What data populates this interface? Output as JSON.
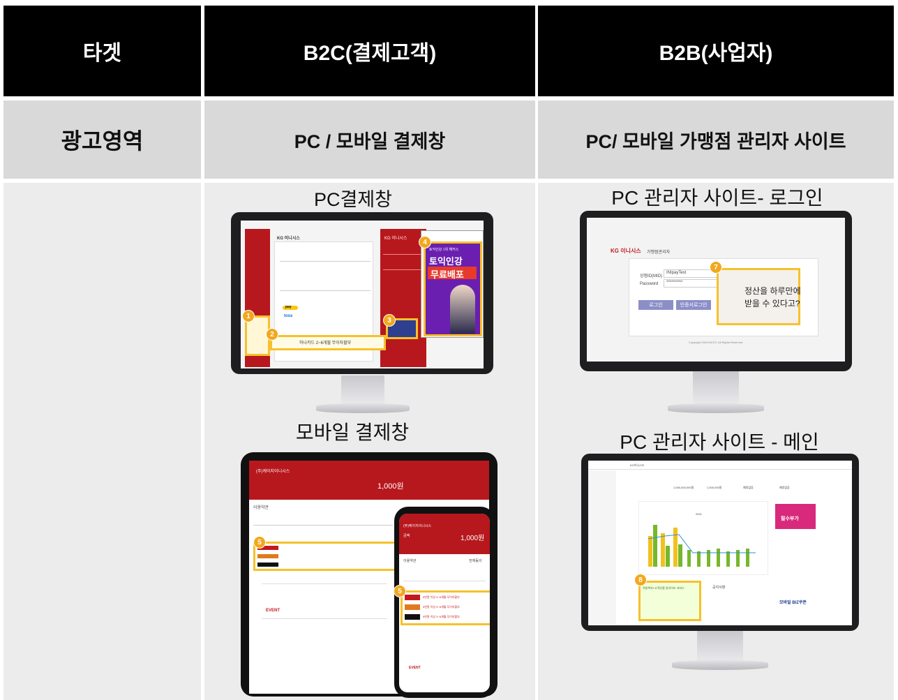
{
  "header": {
    "col1": "타겟",
    "col2": "B2C(결제고객)",
    "col3": "B2B(사업자)"
  },
  "subheader": {
    "col1": "광고영역",
    "col2": "PC / 모바일 결제창",
    "col3": "PC/ 모바일 가맹점 관리자 사이트"
  },
  "b2c": {
    "pc_caption": "PC결제창",
    "mobile_caption": "모바일 결제창",
    "pc_screen": {
      "brand": "KG 이니시스",
      "ad_line1": "토익인강 1위 해커스",
      "ad_line2": "토익인강",
      "ad_line3": "무료배포",
      "card_banner": "하나카드 2~6개월 무이자할부",
      "pay_label": "pay",
      "toss_label": "toss",
      "badges": [
        "1",
        "2",
        "3",
        "4"
      ]
    },
    "mobile_screen": {
      "merchant": "(주)케이지이니시스",
      "amount_label": "금액",
      "amount": "1,000원",
      "terms": "이용약관",
      "agree_all": "전체동의",
      "badge": "5",
      "event_label": "EVENT",
      "rows": [
        "신한카드",
        "KB국민카드",
        "현대카드"
      ],
      "row_text": "5만원 이상 3~6개월 무이자할부"
    }
  },
  "b2b": {
    "login_caption": "PC 관리자 사이트- 로그인",
    "main_caption": "PC 관리자 사이트 - 메인",
    "login_screen": {
      "brand": "KG 이니시스",
      "subtitle": "가맹점관리자",
      "id_label": "상점ID(MID)",
      "id_value": "INIpayTest",
      "pw_label": "Password",
      "pw_value": "**********",
      "login_btn": "로그인",
      "cert_btn": "인증서로그인",
      "ad_text1": "정산을 하루만에",
      "ad_text2": "받을 수 있다고?",
      "badge": "7",
      "copyright": "Copyright 2018 INICIS. All Rights Reserved."
    },
    "main_screen": {
      "brand": "KG이니시스",
      "badge": "8",
      "stats": [
        "1,000,000,000원",
        "1,000,000원",
        "예정없음",
        "예정없음"
      ],
      "chart_year": "2021",
      "ad_right": "필수부가",
      "coupon": "모바일 BIZ쿠폰",
      "notice": "공지사항",
      "banner": "직원복지+고객선물 일석이조 서비스"
    }
  },
  "colors": {
    "header_bg": "#000000",
    "subheader_bg": "#d9d9d9",
    "body_bg": "#ececec",
    "inicis_red": "#b7181d",
    "highlight": "#f6c12b"
  }
}
